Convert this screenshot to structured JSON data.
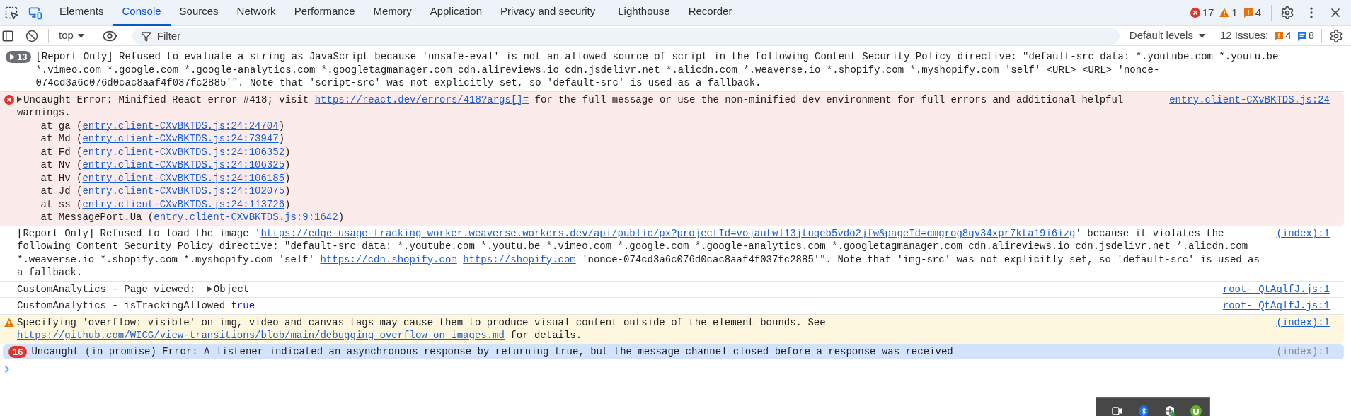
{
  "tabs": [
    {
      "label": "Elements",
      "selected": false
    },
    {
      "label": "Console",
      "selected": true
    },
    {
      "label": "Sources",
      "selected": false
    },
    {
      "label": "Network",
      "selected": false
    },
    {
      "label": "Performance",
      "selected": false
    },
    {
      "label": "Memory",
      "selected": false
    },
    {
      "label": "Application",
      "selected": false
    },
    {
      "label": "Privacy and security",
      "selected": false
    },
    {
      "label": "Lighthouse",
      "selected": false
    },
    {
      "label": "Recorder",
      "selected": false
    }
  ],
  "counters": [
    {
      "kind": "error",
      "count": "17"
    },
    {
      "kind": "warning",
      "count": "1"
    },
    {
      "kind": "issue",
      "count": "4"
    }
  ],
  "toolbar": {
    "context": "top",
    "filter": {
      "placeholder": "Filter"
    },
    "levels": "Default levels",
    "issues_label": "12 Issues:",
    "issues": [
      {
        "kind": "issue",
        "count": "4"
      },
      {
        "kind": "info",
        "count": "8"
      }
    ]
  },
  "messages": [
    {
      "kind": "info",
      "selected": false,
      "count": "13",
      "parts": [
        {
          "kind": "text",
          "text": "[Report Only] Refused to evaluate a string as JavaScript because 'unsafe-eval' is not an allowed source of script in the following Content Security Policy directive: \"default-src data: *.youtube.com *.youtu.be *.vimeo.com *.google.com *.google-analytics.com *.googletagmanager.com cdn.alireviews.io cdn.jsdelivr.net *.alicdn.com *.weaverse.io *.shopify.com *.myshopify.com 'self' <URL> <URL> 'nonce-074cd3a6c076d0cac8aaf4f037fc2885'\". Note that 'script-src' was not explicitly set, so 'default-src' is used as a fallback."
        }
      ]
    },
    {
      "kind": "error",
      "selected": false,
      "source": {
        "text": "entry.client-CXvBKTDS.js:24",
        "linked": true
      },
      "parts": [
        {
          "kind": "toggle"
        },
        {
          "kind": "text",
          "text": "Uncaught Error: Minified React error #418; visit "
        },
        {
          "kind": "link",
          "text": "https://react.dev/errors/418?args[]="
        },
        {
          "kind": "text",
          "text": " for the full message or use the non-minified dev environment for full errors and additional helpful warnings."
        }
      ],
      "stack": [
        {
          "prefix": "    at ga (",
          "link": "entry.client-CXvBKTDS.js:24:24704",
          "suffix": ")"
        },
        {
          "prefix": "    at Md (",
          "link": "entry.client-CXvBKTDS.js:24:73947",
          "suffix": ")"
        },
        {
          "prefix": "    at Fd (",
          "link": "entry.client-CXvBKTDS.js:24:106352",
          "suffix": ")"
        },
        {
          "prefix": "    at Nv (",
          "link": "entry.client-CXvBKTDS.js:24:106325",
          "suffix": ")"
        },
        {
          "prefix": "    at Hv (",
          "link": "entry.client-CXvBKTDS.js:24:106185",
          "suffix": ")"
        },
        {
          "prefix": "    at Jd (",
          "link": "entry.client-CXvBKTDS.js:24:102075",
          "suffix": ")"
        },
        {
          "prefix": "    at ss (",
          "link": "entry.client-CXvBKTDS.js:24:113726",
          "suffix": ")"
        },
        {
          "prefix": "    at MessagePort.Ua (",
          "link": "entry.client-CXvBKTDS.js:9:1642",
          "suffix": ")"
        }
      ]
    },
    {
      "kind": "log",
      "selected": false,
      "source": {
        "text": "(index):1",
        "linked": true
      },
      "parts": [
        {
          "kind": "text",
          "text": "[Report Only] Refused to load the image '"
        },
        {
          "kind": "link",
          "text": "https://edge-usage-tracking-worker.weaverse.workers.dev/api/public/px?projectId=vojautwl13jtuqeb5vdo2jfw&pageId=cmgrog8qv34xpr7kta19i6izg"
        },
        {
          "kind": "text",
          "text": "' because it violates the following Content Security Policy directive: \"default-src data: *.youtube.com *.youtu.be *.vimeo.com *.google.com *.google-analytics.com *.googletagmanager.com cdn.alireviews.io cdn.jsdelivr.net *.alicdn.com *.weaverse.io *.shopify.com *.myshopify.com 'self' "
        },
        {
          "kind": "link",
          "text": "https://cdn.shopify.com"
        },
        {
          "kind": "link",
          "text": "https://shopify.com"
        },
        {
          "kind": "text",
          "text": " 'nonce-074cd3a6c076d0cac8aaf4f037fc2885'\". Note that 'img-src' was not explicitly set, so 'default-src' is used as a fallback."
        }
      ]
    },
    {
      "kind": "log",
      "selected": false,
      "source": {
        "text": "root-_QtAqlfJ.js:1",
        "linked": true
      },
      "parts": [
        {
          "kind": "text",
          "text": "CustomAnalytics - Page viewed:  "
        },
        {
          "kind": "toggle"
        },
        {
          "kind": "text",
          "text": "Object"
        }
      ]
    },
    {
      "kind": "log",
      "selected": false,
      "source": {
        "text": "root-_QtAqlfJ.js:1",
        "linked": true
      },
      "parts": [
        {
          "kind": "text",
          "text": "CustomAnalytics - isTrackingAllowed "
        },
        {
          "kind": "value",
          "text": "true"
        }
      ]
    },
    {
      "kind": "warning",
      "selected": false,
      "source": {
        "text": "(index):1",
        "linked": true
      },
      "parts": [
        {
          "kind": "text",
          "text": "Specifying 'overflow: visible' on img, video and canvas tags may cause them to produce visual content outside of the element bounds. See "
        },
        {
          "kind": "link",
          "text": "https://github.com/WICG/view-transitions/blob/main/debugging_overflow_on_images.md"
        },
        {
          "kind": "text",
          "text": " for details."
        }
      ]
    },
    {
      "kind": "error",
      "selected": true,
      "count": "16",
      "source": {
        "text": "(index):1",
        "linked": false
      },
      "parts": [
        {
          "kind": "text",
          "text": "Uncaught (in promise) Error: A listener indicated an asynchronous response by returning true, but the message channel closed before a response was received"
        }
      ]
    }
  ]
}
